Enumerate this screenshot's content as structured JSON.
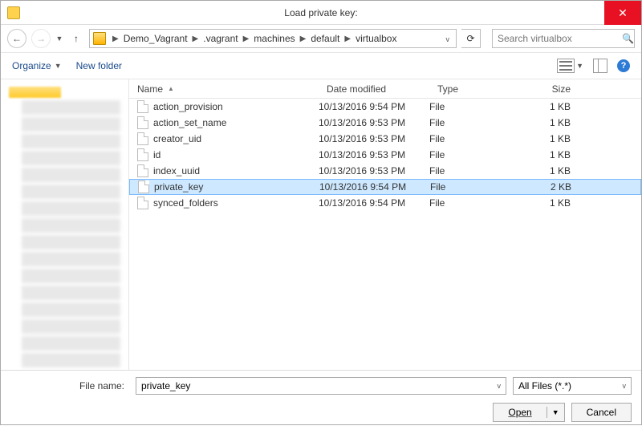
{
  "title": "Load private key:",
  "nav": {
    "crumbs": [
      "Demo_Vagrant",
      ".vagrant",
      "machines",
      "default",
      "virtualbox"
    ],
    "search_placeholder": "Search virtualbox"
  },
  "toolbar": {
    "organize": "Organize",
    "new_folder": "New folder"
  },
  "columns": {
    "name": "Name",
    "date": "Date modified",
    "type": "Type",
    "size": "Size"
  },
  "files": [
    {
      "name": "action_provision",
      "date": "10/13/2016 9:54 PM",
      "type": "File",
      "size": "1 KB",
      "selected": false
    },
    {
      "name": "action_set_name",
      "date": "10/13/2016 9:53 PM",
      "type": "File",
      "size": "1 KB",
      "selected": false
    },
    {
      "name": "creator_uid",
      "date": "10/13/2016 9:53 PM",
      "type": "File",
      "size": "1 KB",
      "selected": false
    },
    {
      "name": "id",
      "date": "10/13/2016 9:53 PM",
      "type": "File",
      "size": "1 KB",
      "selected": false
    },
    {
      "name": "index_uuid",
      "date": "10/13/2016 9:53 PM",
      "type": "File",
      "size": "1 KB",
      "selected": false
    },
    {
      "name": "private_key",
      "date": "10/13/2016 9:54 PM",
      "type": "File",
      "size": "2 KB",
      "selected": true
    },
    {
      "name": "synced_folders",
      "date": "10/13/2016 9:54 PM",
      "type": "File",
      "size": "1 KB",
      "selected": false
    }
  ],
  "footer": {
    "filename_label": "File name:",
    "filename_value": "private_key",
    "filter": "All Files (*.*)",
    "open": "Open",
    "cancel": "Cancel"
  }
}
